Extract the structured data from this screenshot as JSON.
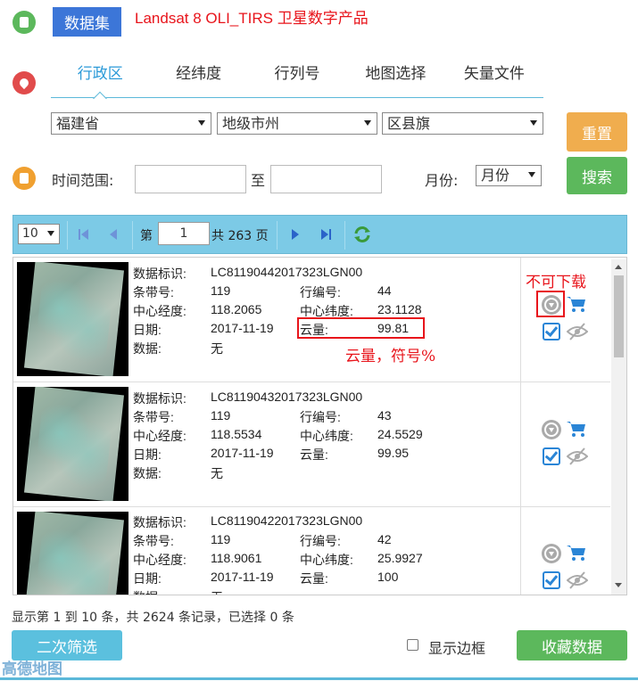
{
  "header": {
    "dataset_button": "数据集",
    "product_title": "Landsat 8 OLI_TIRS 卫星数字产品"
  },
  "tabs": [
    {
      "label": "行政区",
      "active": true
    },
    {
      "label": "经纬度",
      "active": false
    },
    {
      "label": "行列号",
      "active": false
    },
    {
      "label": "地图选择",
      "active": false
    },
    {
      "label": "矢量文件",
      "active": false
    }
  ],
  "selects": {
    "province": "福建省",
    "city": "地级市州",
    "county": "区县旗"
  },
  "buttons": {
    "reset": "重置",
    "search": "搜索",
    "filter": "二次筛选",
    "favorite": "收藏数据"
  },
  "time": {
    "label": "时间范围:",
    "to": "至",
    "month_label": "月份:",
    "month_value": "月份"
  },
  "pager": {
    "page_size": "10",
    "page_prefix": "第",
    "page_value": "1",
    "page_total": "共 263 页"
  },
  "labels": {
    "id": "数据标识:",
    "path": "条带号:",
    "row": "行编号:",
    "lon": "中心经度:",
    "lat": "中心纬度:",
    "date": "日期:",
    "cloud": "云量:",
    "data": "数据:"
  },
  "items": [
    {
      "id": "LC81190442017323LGN00",
      "path": "119",
      "row": "44",
      "lon": "118.2065",
      "lat": "23.1128",
      "date": "2017-11-19",
      "cloud": "99.81",
      "data": "无"
    },
    {
      "id": "LC81190432017323LGN00",
      "path": "119",
      "row": "43",
      "lon": "118.5534",
      "lat": "24.5529",
      "date": "2017-11-19",
      "cloud": "99.95",
      "data": "无"
    },
    {
      "id": "LC81190422017323LGN00",
      "path": "119",
      "row": "42",
      "lon": "118.9061",
      "lat": "25.9927",
      "date": "2017-11-19",
      "cloud": "100",
      "data": "无"
    }
  ],
  "annotations": {
    "no_download": "不可下载",
    "cloud_note": "云量，符号%"
  },
  "footer": {
    "info": "显示第 1 到 10 条，共 2624 条记录，已选择 0 条",
    "show_border": "显示边框",
    "map_brand": "高德地图"
  },
  "colors": {
    "primary": "#3c76d8",
    "accent_red": "#e8141b",
    "pager_bg": "#7ccae6",
    "reset": "#f0ad4e",
    "search": "#5cb85c",
    "filter": "#5bc0de"
  }
}
